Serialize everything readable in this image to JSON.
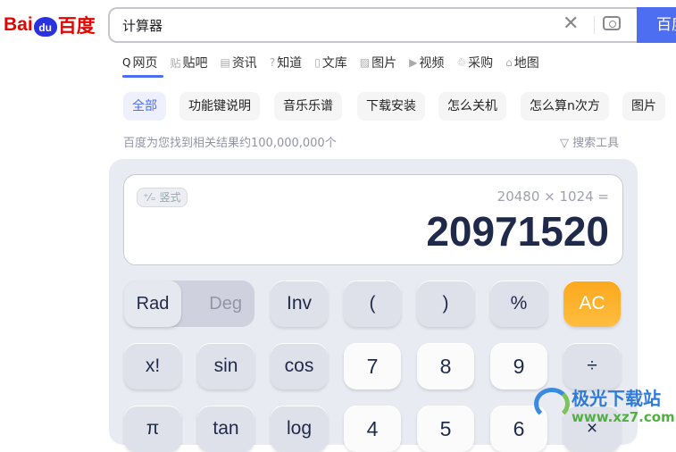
{
  "logo": {
    "left": "Bai",
    "paw": "du",
    "right": "百度"
  },
  "search": {
    "value": "计算器",
    "button": "百度一下"
  },
  "tabs": [
    {
      "icon": "Q",
      "label": "网页"
    },
    {
      "icon": "贴",
      "label": "贴吧"
    },
    {
      "icon": "▤",
      "label": "资讯"
    },
    {
      "icon": "?",
      "label": "知道"
    },
    {
      "icon": "▯",
      "label": "文库"
    },
    {
      "icon": "▨",
      "label": "图片"
    },
    {
      "icon": "▶",
      "label": "视频"
    },
    {
      "icon": "♲",
      "label": "采购"
    },
    {
      "icon": "⌂",
      "label": "地图"
    }
  ],
  "chips": [
    "全部",
    "功能键说明",
    "音乐乐谱",
    "下载安装",
    "怎么关机",
    "怎么算n次方",
    "图片"
  ],
  "result_count": "百度为您找到相关结果约100,000,000个",
  "search_tools": "搜索工具",
  "calculator": {
    "mode_label": "竖式",
    "mode_icon": "⁺⁄₌",
    "expression": "20480 × 1024 =",
    "result": "20971520",
    "rad": "Rad",
    "deg": "Deg",
    "row1": [
      "Inv",
      "(",
      ")",
      "%",
      "AC"
    ],
    "row2": [
      "x!",
      "sin",
      "cos",
      "7",
      "8",
      "9",
      "÷"
    ],
    "row3": [
      "π",
      "tan",
      "log",
      "4",
      "5",
      "6",
      "×"
    ]
  },
  "watermark": {
    "title": "极光下载站",
    "url": "www.xz7.com"
  }
}
